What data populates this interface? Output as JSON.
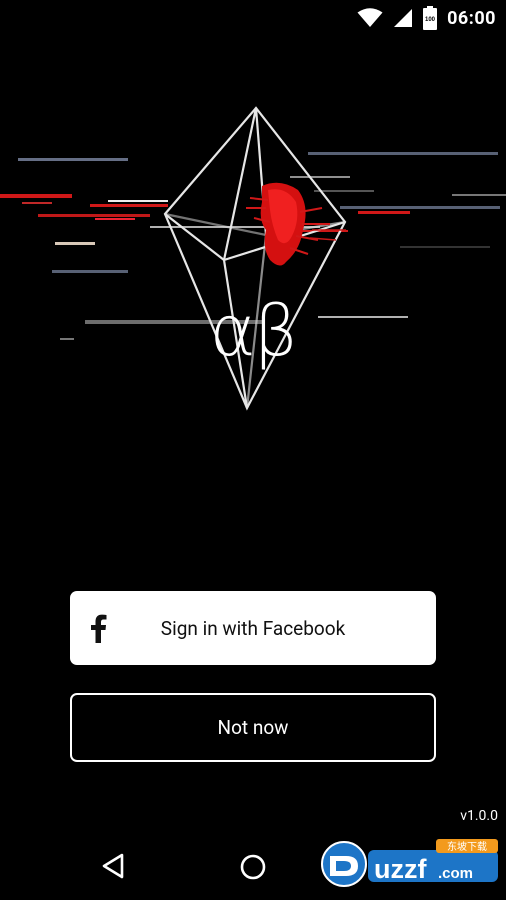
{
  "status_bar": {
    "time": "06:00",
    "battery_level": "100",
    "icons": [
      "wifi-icon",
      "cell-signal-icon",
      "battery-icon"
    ]
  },
  "hero": {
    "logo_text": "αβ"
  },
  "buttons": {
    "facebook_label": "Sign in with Facebook",
    "facebook_icon": "f",
    "not_now_label": "Not now"
  },
  "footer": {
    "version": "v1.0.0"
  },
  "nav_bar": {
    "icons": [
      "back-icon",
      "home-icon"
    ]
  },
  "watermark": {
    "brand_letters": "uzzf",
    "brand_suffix": ".com",
    "chinese": "东坡下载"
  },
  "colors": {
    "background": "#000000",
    "accent_red": "#e01010",
    "button_fill": "#ffffff"
  }
}
